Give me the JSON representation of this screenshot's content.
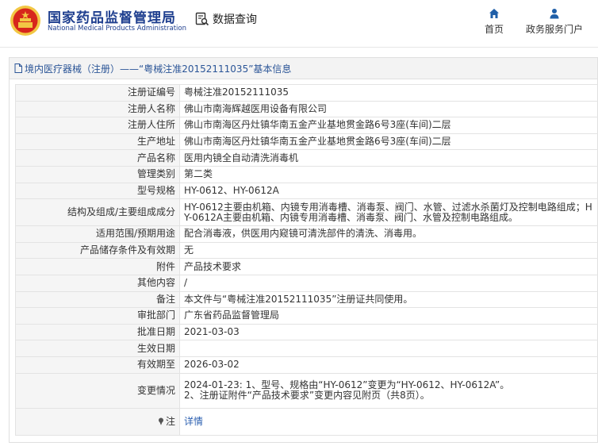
{
  "header": {
    "brand_cn": "国家药品监督管理局",
    "brand_en": "National Medical Products Administration",
    "query_label": "数据查询",
    "nav": {
      "home": "首页",
      "portal": "政务服务门户"
    }
  },
  "colors": {
    "brand_blue": "#1f3f8f",
    "link_blue": "#2b5fb0",
    "logo_red": "#d7261c",
    "logo_gold": "#f2c744"
  },
  "panel": {
    "title": "境内医疗器械（注册）——“粤械注准20152111035”基本信息"
  },
  "rows": [
    {
      "label": "注册证编号",
      "value": "粤械注准20152111035"
    },
    {
      "label": "注册人名称",
      "value": "佛山市南海辉越医用设备有限公司"
    },
    {
      "label": "注册人住所",
      "value": "佛山市南海区丹灶镇华南五金产业基地贯金路6号3座(车间)二层"
    },
    {
      "label": "生产地址",
      "value": "佛山市南海区丹灶镇华南五金产业基地贯金路6号3座(车间)二层"
    },
    {
      "label": "产品名称",
      "value": "医用内镜全自动清洗消毒机"
    },
    {
      "label": "管理类别",
      "value": "第二类"
    },
    {
      "label": "型号规格",
      "value": "HY-0612、HY-0612A"
    },
    {
      "label": "结构及组成/主要组成成分",
      "value": "HY-0612主要由机箱、内镜专用消毒槽、消毒泵、阀门、水管、过滤水杀菌灯及控制电路组成；HY-0612A主要由机箱、内镜专用消毒槽、消毒泵、阀门、水管及控制电路组成。"
    },
    {
      "label": "适用范围/预期用途",
      "value": "配合消毒液，供医用内窥镜可清洗部件的清洗、消毒用。"
    },
    {
      "label": "产品储存条件及有效期",
      "value": "无"
    },
    {
      "label": "附件",
      "value": "产品技术要求"
    },
    {
      "label": "其他内容",
      "value": "/"
    },
    {
      "label": "备注",
      "value": "本文件与“粤械注准20152111035”注册证共同使用。"
    },
    {
      "label": "审批部门",
      "value": "广东省药品监督管理局"
    },
    {
      "label": "批准日期",
      "value": "2021-03-03"
    },
    {
      "label": "生效日期",
      "value": ""
    },
    {
      "label": "有效期至",
      "value": "2026-03-02"
    },
    {
      "label": "变更情况",
      "value_line1": "2024-01-23: 1、型号、规格由“HY-0612”变更为“HY-0612、HY-0612A”。",
      "value_line2": "2、注册证附件“产品技术要求”变更内容见附页（共8页）。"
    },
    {
      "label": "注",
      "value": "详情"
    }
  ]
}
